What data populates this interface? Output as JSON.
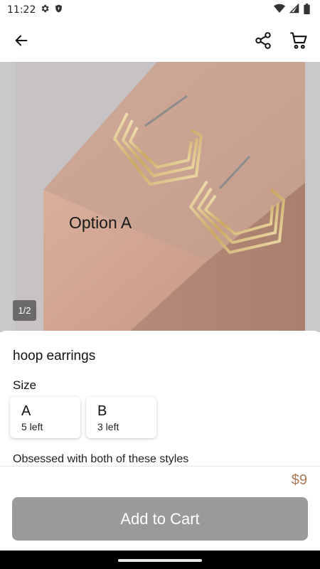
{
  "status_bar": {
    "time": "11:22",
    "left_icons": [
      "gear-icon",
      "shield-icon"
    ],
    "right_icons": [
      "wifi-icon",
      "cellular-signal-icon",
      "battery-icon"
    ]
  },
  "app_bar": {
    "back_icon": "arrow-back-icon",
    "share_icon": "share-icon",
    "cart_icon": "cart-icon"
  },
  "hero": {
    "option_text": "Option A",
    "page_indicator": "1/2"
  },
  "product": {
    "title": "hoop earrings",
    "size_label": "Size",
    "sizes": [
      {
        "name": "A",
        "stock": "5 left"
      },
      {
        "name": "B",
        "stock": "3 left"
      }
    ],
    "description": "Obsessed with both of these styles",
    "price": "$9",
    "price_color": "#a8795a"
  },
  "cta": {
    "label": "Add to Cart",
    "color": "#9a9a9a"
  }
}
